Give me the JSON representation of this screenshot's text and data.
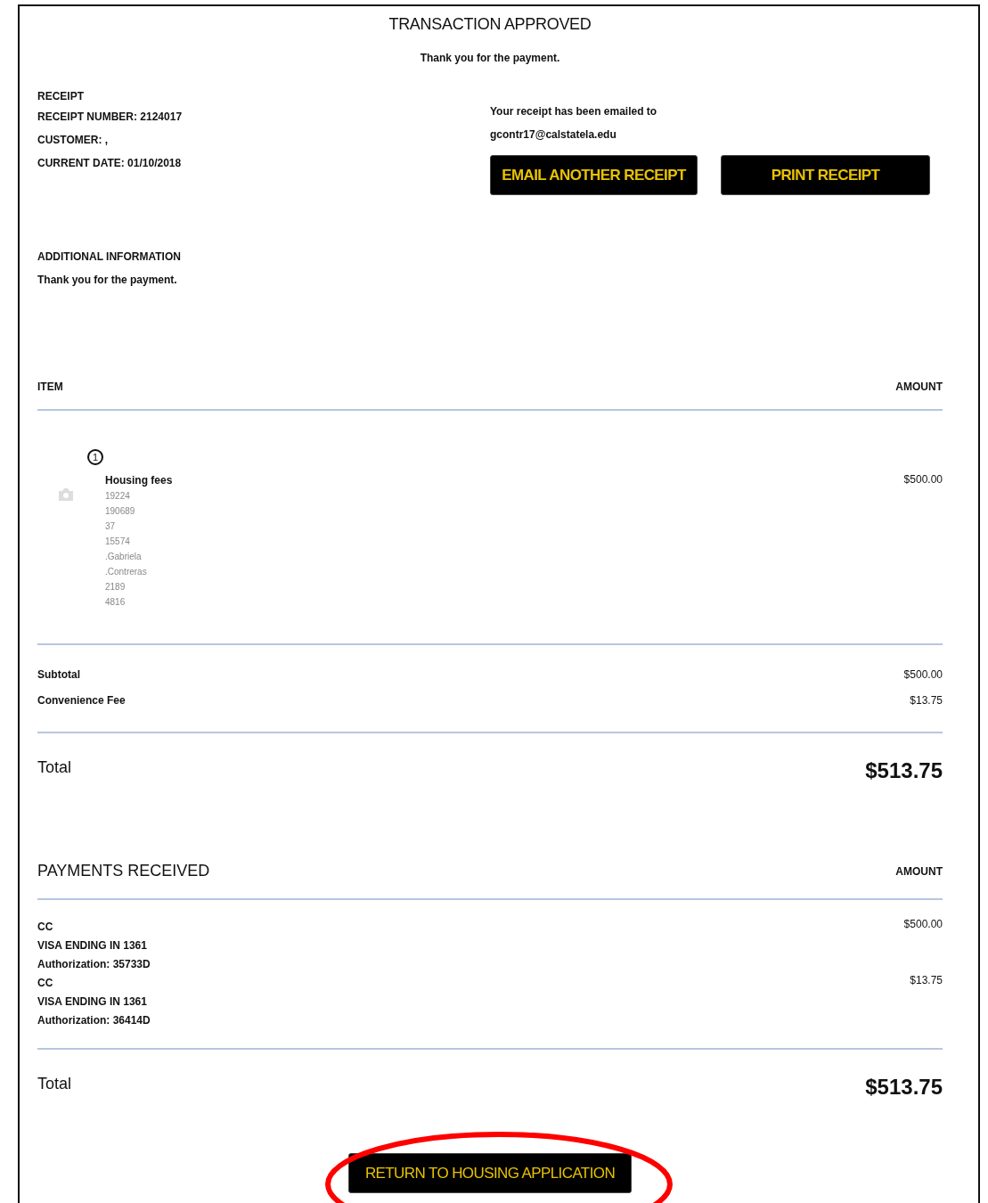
{
  "header": {
    "title": "TRANSACTION APPROVED",
    "message": "Thank you for the payment."
  },
  "receipt": {
    "heading": "RECEIPT",
    "lines": [
      "RECEIPT NUMBER: 2124017",
      "CUSTOMER: ,",
      "CURRENT DATE: 01/10/2018"
    ]
  },
  "email": {
    "lines": [
      "Your receipt has been emailed to",
      "gcontr17@calstatela.edu"
    ],
    "buttons": [
      "EMAIL ANOTHER RECEIPT",
      "PRINT RECEIPT"
    ]
  },
  "additional": {
    "heading": "ADDITIONAL INFORMATION",
    "text": "Thank you for the payment."
  },
  "items_table": {
    "columns": [
      "ITEM",
      "AMOUNT"
    ],
    "rows": [
      {
        "quantity": "1",
        "name": "Housing fees",
        "details": [
          "19224",
          "190689",
          "37",
          "15574",
          ".Gabriela",
          ".Contreras",
          "2189",
          "4816"
        ],
        "amount": "$500.00"
      }
    ]
  },
  "summary": [
    {
      "label": "Subtotal",
      "amount": "$500.00"
    },
    {
      "label": "Convenience Fee",
      "amount": "$13.75"
    }
  ],
  "total": {
    "label": "Total",
    "amount": "$513.75"
  },
  "payments": {
    "heading": "PAYMENTS RECEIVED",
    "amount_heading": "AMOUNT",
    "rows": [
      {
        "lines": [
          "CC",
          "VISA ENDING IN 1361",
          "Authorization: 35733D"
        ],
        "amount": "$500.00"
      },
      {
        "lines": [
          "CC",
          "VISA ENDING IN 1361",
          "Authorization: 36414D"
        ],
        "amount": "$13.75"
      }
    ]
  },
  "payments_total": {
    "label": "Total",
    "amount": "$513.75"
  },
  "return_button": {
    "label": "RETURN TO HOUSING APPLICATION",
    "highlighted": true
  }
}
